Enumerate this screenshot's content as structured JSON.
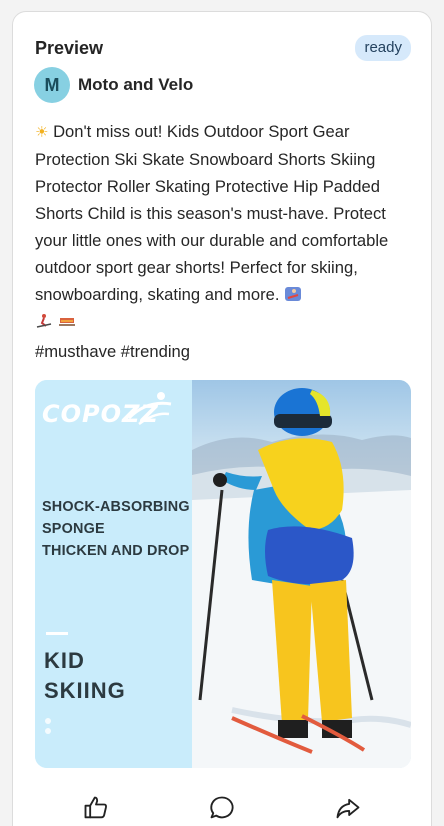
{
  "card": {
    "title": "Preview",
    "status": "ready"
  },
  "author": {
    "initial": "M",
    "name": "Moto and Velo"
  },
  "post": {
    "body": "Don't miss out! Kids Outdoor Sport Gear Protection Ski Skate Snowboard Shorts Skiing Protector Roller Skating Protective Hip Padded Shorts Child is this season's must-have. Protect your little ones with our durable and comfortable outdoor sport gear shorts! Perfect for skiing, snowboarding, skating and more.",
    "leading_emoji": "sun-emoji",
    "trailing_emojis": [
      "snowboarder-emoji",
      "skier-emoji",
      "sled-emoji"
    ],
    "hashtags": "#musthave #trending"
  },
  "image": {
    "brand": "COPOZZ",
    "feature_lines": [
      "SHOCK-ABSORBING",
      "SPONGE",
      "THICKEN AND DROP"
    ],
    "headline_lines": [
      "KID",
      "SKIING"
    ],
    "colors": {
      "left_panel": "#c9ecfb",
      "jacket_yellow": "#f7d21d",
      "jacket_blue": "#2a9ad6",
      "pads_blue": "#2b57c8",
      "helmet_blue": "#1a74d4"
    }
  },
  "actions": {
    "like_icon": "thumbs-up-icon",
    "comment_icon": "comment-icon",
    "share_icon": "share-icon"
  }
}
